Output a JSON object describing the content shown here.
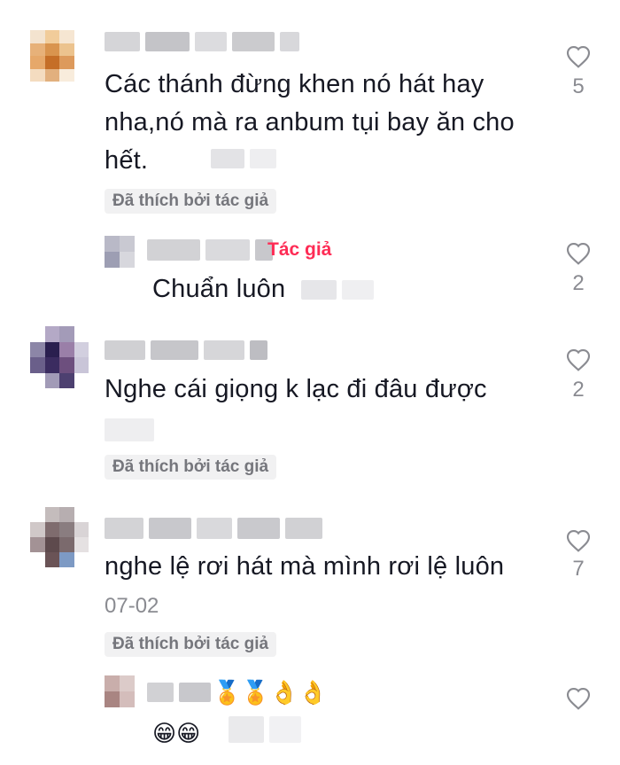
{
  "comments": [
    {
      "text": "Các thánh đừng khen nó hát hay nha,nó mà ra anbum tụi bay ăn cho hết.",
      "likes": "5",
      "liked_by_author": "Đã thích bởi tác giả",
      "reply": {
        "author_badge": "Tác giả",
        "text": "Chuẩn luôn",
        "likes": "2"
      }
    },
    {
      "text": "Nghe cái giọng k lạc đi đâu được",
      "likes": "2",
      "liked_by_author": "Đã thích bởi tác giả"
    },
    {
      "text": "nghe lệ rơi hát mà mình rơi lệ luôn",
      "date": "07-02",
      "likes": "7",
      "liked_by_author": "Đã thích bởi tác giả",
      "reply": {
        "name_emojis": "🏅🏅👌👌",
        "text": "😁😁",
        "likes": ""
      }
    }
  ],
  "colors": {
    "author": "#fe2c55",
    "muted": "#8a8b91",
    "badge_bg": "#f1f1f2"
  },
  "icons": {
    "like": "heart-outline-icon"
  }
}
